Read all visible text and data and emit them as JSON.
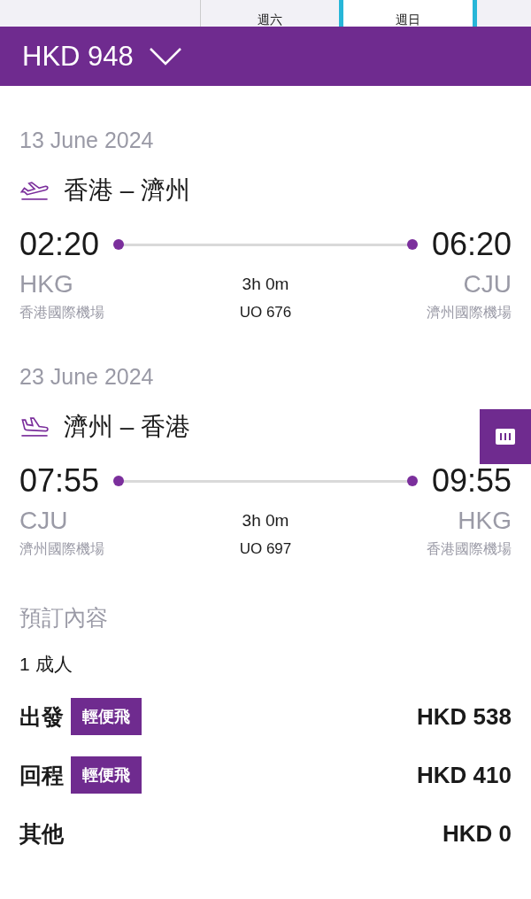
{
  "day_tabs": [
    {
      "label": "週六",
      "selected": false
    },
    {
      "label": "週日",
      "selected": true
    }
  ],
  "header": {
    "total": "HKD 948"
  },
  "flights": [
    {
      "date": "13 June 2024",
      "kind": "depart",
      "route": "香港 – 濟州",
      "dep_time": "02:20",
      "arr_time": "06:20",
      "dep_code": "HKG",
      "duration": "3h 0m",
      "arr_code": "CJU",
      "dep_airport": "香港國際機場",
      "flight_no": "UO 676",
      "arr_airport": "濟州國際機場"
    },
    {
      "date": "23 June 2024",
      "kind": "arrive",
      "route": "濟州 – 香港",
      "dep_time": "07:55",
      "arr_time": "09:55",
      "dep_code": "CJU",
      "duration": "3h 0m",
      "arr_code": "HKG",
      "dep_airport": "濟州國際機場",
      "flight_no": "UO 697",
      "arr_airport": "香港國際機場"
    }
  ],
  "booking": {
    "title": "預訂內容",
    "passengers": "1 成人",
    "lines": [
      {
        "label": "出發",
        "tag": "輕便飛",
        "price": "HKD 538"
      },
      {
        "label": "回程",
        "tag": "輕便飛",
        "price": "HKD 410"
      },
      {
        "label": "其他",
        "price": "HKD 0"
      }
    ]
  }
}
